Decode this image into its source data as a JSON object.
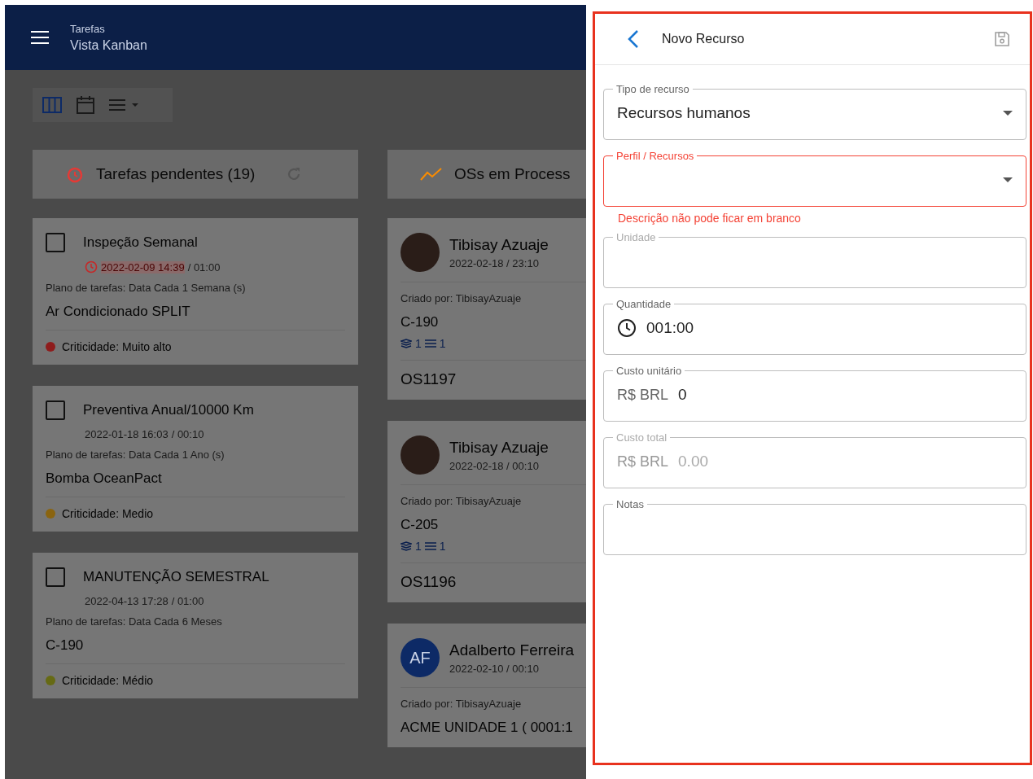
{
  "app_bar": {
    "title": "Tarefas",
    "subtitle": "Vista Kanban"
  },
  "view_toggles": [
    {
      "kind": "kanban",
      "selected": true
    },
    {
      "kind": "calendar",
      "selected": false
    },
    {
      "kind": "list",
      "selected": false
    }
  ],
  "columns": [
    {
      "kind": "tasks",
      "title": "Tarefas pendentes (19)",
      "cards": [
        {
          "title": "Inspeção Semanal",
          "checked": false,
          "overdue": true,
          "schedule": "2022-02-09 14:39",
          "duration": " / 01:00",
          "plan": "Plano de tarefas: Data Cada 1 Semana (s)",
          "asset": "Ar Condicionado SPLIT",
          "criticality": "Criticidade: Muito alto",
          "color": "#8e1c1c"
        },
        {
          "title": "Preventiva Anual/10000 Km",
          "checked": false,
          "overdue": false,
          "schedule": "2022-01-18 16:03",
          "duration": " / 00:10",
          "plan": "Plano de tarefas: Data Cada 1 Ano (s)",
          "asset": "Bomba OceanPact",
          "criticality": "Criticidade: Medio",
          "color": "#8a6410"
        },
        {
          "title": "MANUTENÇÃO SEMESTRAL",
          "checked": false,
          "overdue": false,
          "schedule": "2022-04-13 17:28",
          "duration": " / 01:00",
          "plan": "Plano de tarefas: Data Cada 6 Meses",
          "asset": "C-190",
          "criticality": "Criticidade: Médio",
          "color": "#666a14"
        }
      ]
    },
    {
      "kind": "orders",
      "title": "OSs em Process",
      "cards": [
        {
          "name": "Tibisay Azuaje",
          "date": "2022-02-18 / 23:10",
          "creator": "Criado por: TibisayAzuaje",
          "asset": "C-190",
          "counts": [
            "1",
            "1"
          ],
          "code": "OS1197"
        },
        {
          "name": "Tibisay Azuaje",
          "date": "2022-02-18 / 00:10",
          "creator": "Criado por: TibisayAzuaje",
          "asset": "C-205",
          "counts": [
            "1",
            "1"
          ],
          "code": "OS1196"
        },
        {
          "initials": "AF",
          "name": "Adalberto Ferreira",
          "date": "2022-02-10 / 00:10",
          "creator": "Criado por: TibisayAzuaje",
          "asset": "ACME UNIDADE 1 ( 0001:1"
        }
      ]
    }
  ],
  "drawer": {
    "title": "Novo Recurso",
    "fields": [
      {
        "kind": "select",
        "label": "Tipo de recurso",
        "value": "Recursos humanos",
        "error": false,
        "disabled": false
      },
      {
        "kind": "select",
        "label": "Perfil / Recursos",
        "error": true,
        "error_text": "Descrição não pode ficar em branco",
        "disabled": false
      },
      {
        "kind": "text",
        "label": "Unidade",
        "disabled": true,
        "error": false
      },
      {
        "kind": "time",
        "label": "Quantidade",
        "value": "001:00",
        "disabled": false,
        "error": false
      },
      {
        "kind": "money",
        "label": "Custo unitário",
        "prefix": "R$ BRL",
        "value": "0",
        "disabled": false,
        "error": false
      },
      {
        "kind": "money",
        "label": "Custo total",
        "prefix": "R$ BRL",
        "value": "0.00",
        "disabled": true,
        "error": false
      },
      {
        "kind": "text",
        "label": "Notas",
        "disabled": false,
        "error": false
      }
    ]
  }
}
